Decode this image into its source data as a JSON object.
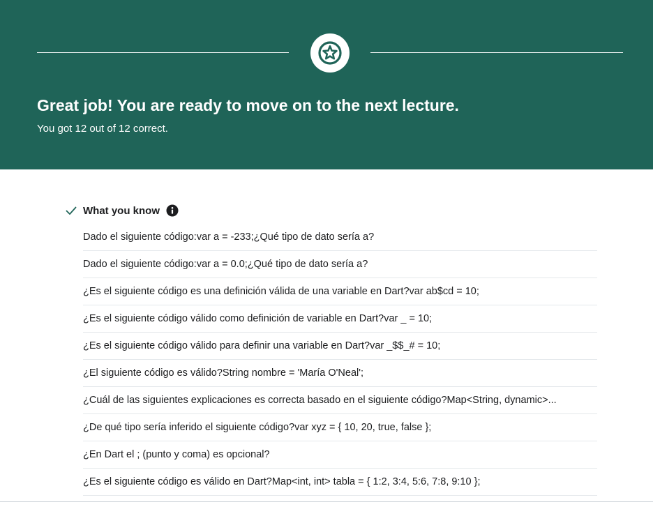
{
  "banner": {
    "icon": "star-icon",
    "heading": "Great job! You are ready to move on to the next lecture.",
    "subtitle": "You got 12 out of 12 correct.",
    "background": "#1f6458"
  },
  "results": {
    "section_title": "What you know",
    "section_icon": "check-icon",
    "info_icon": "info-icon",
    "accent": "#1f6458",
    "questions": [
      "Dado el siguiente código:var a = -233;¿Qué tipo de dato sería a?",
      "Dado el siguiente código:var a = 0.0;¿Qué tipo de dato sería a?",
      "¿Es el siguiente código es una definición válida de una variable en Dart?var ab$cd = 10;",
      "¿Es el siguiente código válido como definición de variable en Dart?var _ = 10;",
      "¿Es el siguiente código válido para definir una variable en Dart?var _$$_# = 10;",
      "¿El siguiente código es válido?String nombre = 'María O'Neal';",
      "¿Cuál de las siguientes explicaciones es correcta basado en el siguiente código?Map<String, dynamic>...",
      "¿De qué tipo sería inferido el siguiente código?var xyz = { 10, 20, true, false };",
      "¿En Dart el ; (punto y coma) es opcional?",
      "¿Es el siguiente código es válido en Dart?Map<int, int> tabla = { 1:2, 3:4, 5:6, 7:8, 9:10 };"
    ]
  }
}
